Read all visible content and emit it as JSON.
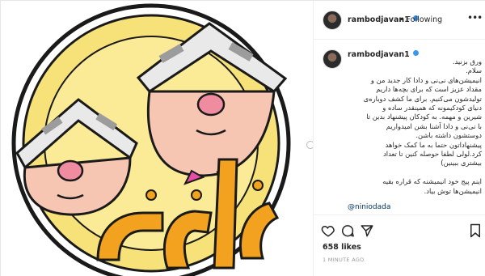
{
  "post": {
    "username": "rambodjavan1",
    "follow_label": "Following",
    "separator": "•",
    "more_icon": "more-dots-icon",
    "caption_lines": [
      "ورق بزنید.",
      "سلام.",
      "انیمیشن‌های نی‌نی و دادا کار جدید من و",
      "مقداد عزیز است که برای بچه‌ها داریم",
      "تولیدشون می‌کنیم. برای ما کشف دوباره‌ی",
      "دنیای کودکیمونه که همینقدر ساده و",
      "شیرین و مهمه. به کودکان پیشنهاد بدین تا",
      "با نی‌نی و دادا آشنا بشن امیدواریم",
      "دوستشون داشته باشن.",
      "پیشنهاداتون حتما به ما کمک خواهد",
      "کرد.لولی لطفا حوصله کنین تا تعداد",
      "بیشتری ببینین)",
      "",
      "اینم پیج خود انیمیشنه که قراره بقیه",
      "انیمیشن‌ها توش بیاد."
    ],
    "tag": "@niniodada",
    "likes": "658 likes",
    "timestamp": "1 MINUTE AGO",
    "image_title": "نی‌نی دادا",
    "colors": {
      "accent_blue": "#3897f0",
      "tag_blue": "#003569",
      "logo_orange": "#f2a21e",
      "logo_yellow": "#f7e27a"
    }
  }
}
